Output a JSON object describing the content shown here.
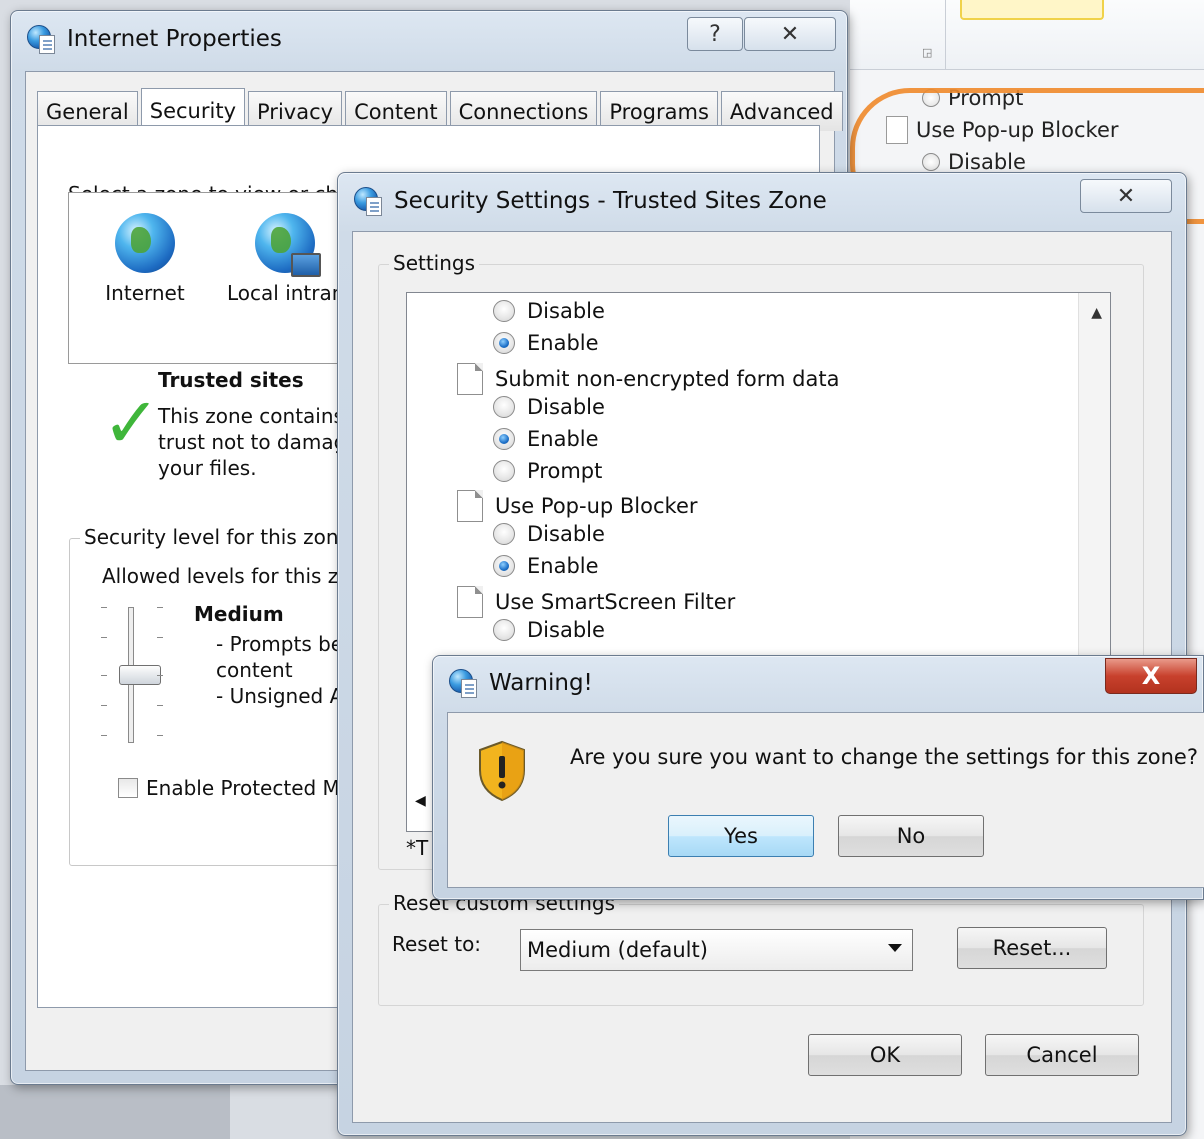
{
  "background": {
    "items": [
      {
        "kind": "radio",
        "label": "Prompt"
      },
      {
        "kind": "doc",
        "label": "Use Pop-up Blocker"
      },
      {
        "kind": "radio",
        "label": "Disable"
      }
    ]
  },
  "internet_properties": {
    "title": "Internet Properties",
    "help_label": "?",
    "close_label": "✕",
    "tabs": [
      "General",
      "Security",
      "Privacy",
      "Content",
      "Connections",
      "Programs",
      "Advanced"
    ],
    "active_tab": "Security",
    "zone_prompt": "Select a zone to view or cha",
    "zones": [
      "Internet",
      "Local intran"
    ],
    "zone_title": "Trusted sites",
    "zone_desc": [
      "This zone contains",
      "trust not to damag",
      "your files."
    ],
    "security_level_title": "Security level for this zone",
    "allowed_levels": "Allowed levels for this zo",
    "level_name": "Medium",
    "level_desc": [
      "- Prompts be",
      "content",
      "- Unsigned A"
    ],
    "protected_mode": "Enable Protected Mo"
  },
  "security_settings": {
    "title": "Security Settings - Trusted Sites Zone",
    "close_label": "✕",
    "settings_label": "Settings",
    "rows": [
      {
        "kind": "radio",
        "label": "Disable",
        "checked": false
      },
      {
        "kind": "radio",
        "label": "Enable",
        "checked": true
      },
      {
        "kind": "doc",
        "label": "Submit non-encrypted form data"
      },
      {
        "kind": "radio",
        "label": "Disable",
        "checked": false
      },
      {
        "kind": "radio",
        "label": "Enable",
        "checked": true
      },
      {
        "kind": "radio",
        "label": "Prompt",
        "checked": false
      },
      {
        "kind": "doc",
        "label": "Use Pop-up Blocker"
      },
      {
        "kind": "radio",
        "label": "Disable",
        "checked": false
      },
      {
        "kind": "radio",
        "label": "Enable",
        "checked": true
      },
      {
        "kind": "doc",
        "label": "Use SmartScreen Filter"
      },
      {
        "kind": "radio",
        "label": "Disable",
        "checked": false
      }
    ],
    "note_prefix": "*T",
    "reset_group": "Reset custom settings",
    "reset_to_label": "Reset to:",
    "reset_value": "Medium (default)",
    "reset_button": "Reset...",
    "ok_button": "OK",
    "cancel_button": "Cancel"
  },
  "warning": {
    "title": "Warning!",
    "close_label": "X",
    "message": "Are you sure you want to change the settings for this zone?",
    "yes": "Yes",
    "no": "No"
  }
}
